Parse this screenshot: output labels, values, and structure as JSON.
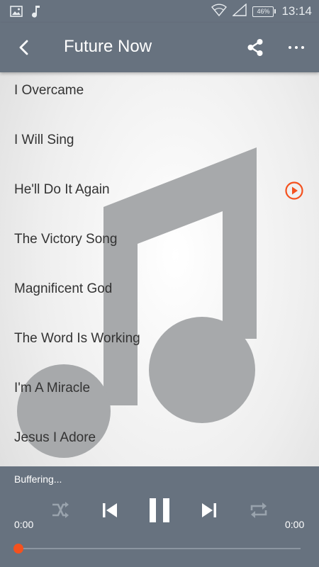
{
  "status_bar": {
    "time": "13:14",
    "battery": "46%",
    "icons": [
      "image-icon",
      "music-note-icon",
      "wifi-icon",
      "signal-icon",
      "battery-icon"
    ]
  },
  "toolbar": {
    "title": "Future Now",
    "back_icon": "back-arrow-icon",
    "share_icon": "share-icon",
    "more_icon": "more-options-icon"
  },
  "songs": [
    {
      "title": "I Overcame"
    },
    {
      "title": "I Will Sing"
    },
    {
      "title": "He'll Do It Again",
      "playing": true
    },
    {
      "title": "The Victory Song"
    },
    {
      "title": "Magnificent God"
    },
    {
      "title": "The Word Is Working"
    },
    {
      "title": "I'm A Miracle"
    },
    {
      "title": "Jesus I Adore"
    }
  ],
  "player": {
    "status": "Buffering...",
    "elapsed": "0:00",
    "total": "0:00",
    "progress": 0,
    "controls": [
      "shuffle-icon",
      "previous-icon",
      "pause-icon",
      "next-icon",
      "repeat-icon"
    ]
  },
  "colors": {
    "bar_background": "#67727f",
    "accent": "#f4511e",
    "text_primary": "#333333",
    "background_note": "#a7a9ab"
  }
}
